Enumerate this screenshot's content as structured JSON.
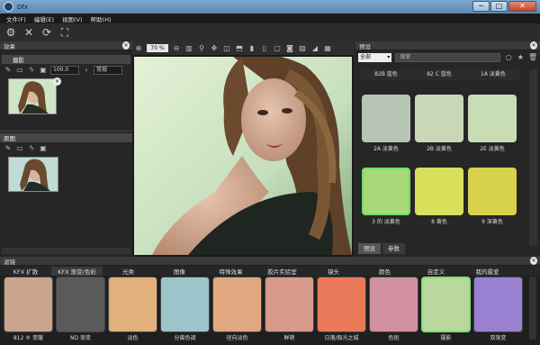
{
  "window": {
    "title": "Dfx",
    "controls": [
      "─",
      "□",
      "✕"
    ]
  },
  "menu": [
    "文件(F)",
    "编辑(E)",
    "视图(V)",
    "帮助(H)"
  ],
  "effects_panel": {
    "title": "效果",
    "layer1": {
      "title": "摄影",
      "opacity": "100.0",
      "mode": "常规"
    },
    "layer2": {
      "title": "原图"
    }
  },
  "viewer": {
    "zoom": "70 %"
  },
  "presets_panel": {
    "title": "预设",
    "category": "全部",
    "search_placeholder": "搜索",
    "top_row": [
      "82B 蓝色",
      "82 C 蓝色",
      "1A 淡黄色"
    ],
    "items": [
      {
        "label": "2A 淡黄色",
        "tint": "#b7c6b4"
      },
      {
        "label": "2B 淡黄色",
        "tint": "#c9d7b8"
      },
      {
        "label": "2E 淡黄色",
        "tint": "#c8dcb6"
      },
      {
        "label": "3 的 淡黄色",
        "tint": "#a8d878"
      },
      {
        "label": "8 黄色",
        "tint": "#d8e05a"
      },
      {
        "label": "9 深黄色",
        "tint": "#d6d24a"
      }
    ],
    "tabs": [
      "预设",
      "参数"
    ]
  },
  "filters_panel": {
    "title": "滤镜",
    "categories": [
      "KFX 扩散",
      "KFX 渐变/色彩",
      "光类",
      "图像",
      "特殊效果",
      "胶片实验室",
      "镜头",
      "颜色",
      "自定义",
      "我的最爱"
    ],
    "items": [
      {
        "label": "812 ® 变暖",
        "tint": "#c9a58d"
      },
      {
        "label": "ND 渐变",
        "tint": "#5a5a5a"
      },
      {
        "label": "淡色",
        "tint": "#e2b07a"
      },
      {
        "label": "分离色调",
        "tint": "#9fc5cc"
      },
      {
        "label": "径向淡色",
        "tint": "#e0a880"
      },
      {
        "label": "鲜艳",
        "tint": "#d89a8a"
      },
      {
        "label": "日落/极光之城",
        "tint": "#e87a5a"
      },
      {
        "label": "色斑",
        "tint": "#d090a0"
      },
      {
        "label": "摄影",
        "tint": "#b8d8a0"
      },
      {
        "label": "双渐变",
        "tint": "#9a80d0"
      }
    ]
  },
  "colors": {
    "accent_green": "#7ee06e",
    "titlebar": "#6f9ac3"
  }
}
